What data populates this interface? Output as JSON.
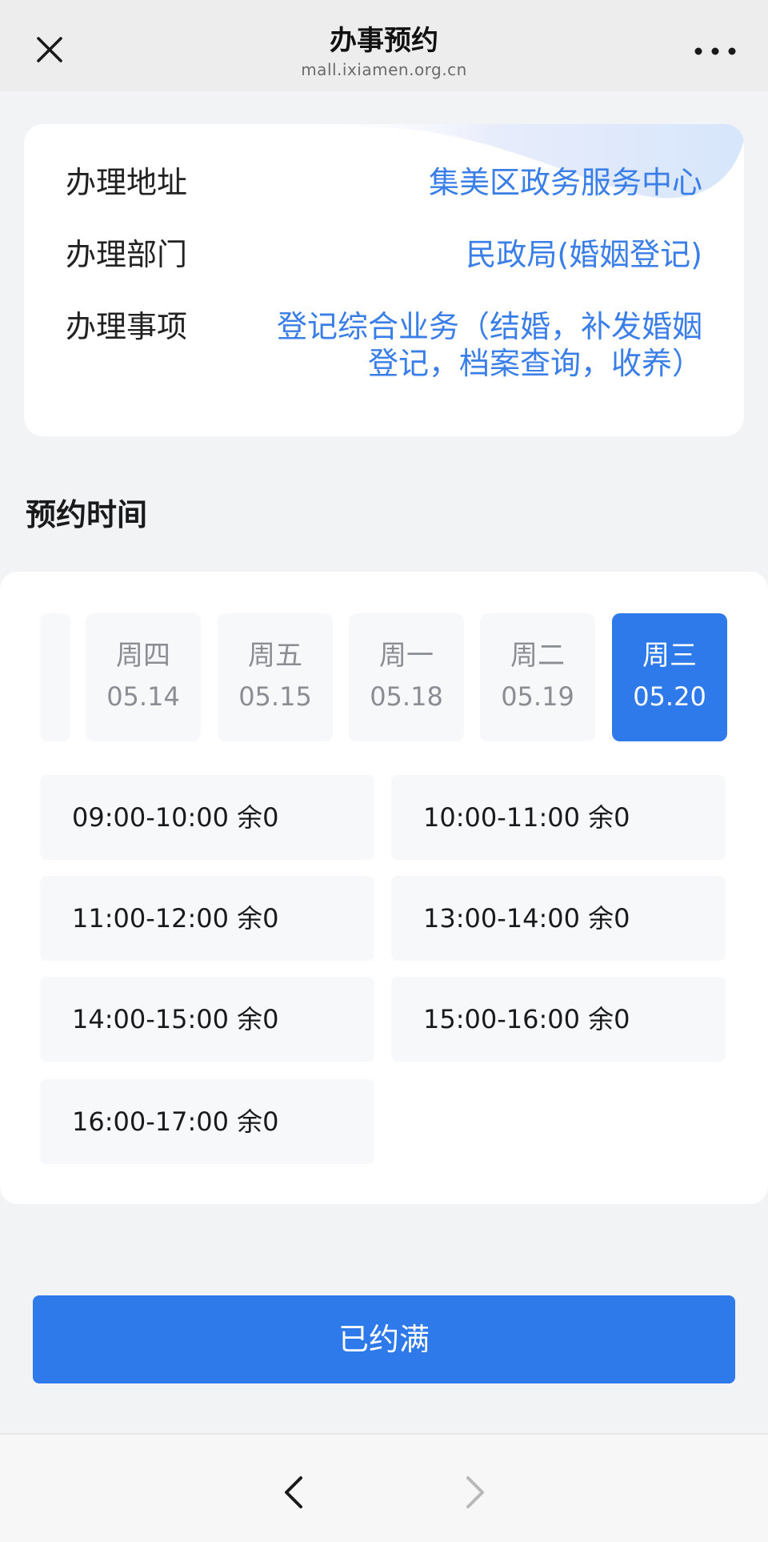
{
  "nav": {
    "title": "办事预约",
    "url": "mall.ixiamen.org.cn",
    "close_icon": "close-icon",
    "more_icon": "more-icon"
  },
  "info": {
    "address_label": "办理地址",
    "address_value": "集美区政务服务中心",
    "department_label": "办理部门",
    "department_value": "民政局(婚姻登记)",
    "matter_label": "办理事项",
    "matter_value_line1": "登记综合业务（结婚，补发婚姻",
    "matter_value_line2": "登记，档案查询，收养）"
  },
  "section_title": "预约时间",
  "dates": [
    {
      "weekday": "",
      "date": ""
    },
    {
      "weekday": "周四",
      "date": "05.14"
    },
    {
      "weekday": "周五",
      "date": "05.15"
    },
    {
      "weekday": "周一",
      "date": "05.18"
    },
    {
      "weekday": "周二",
      "date": "05.19"
    },
    {
      "weekday": "周三",
      "date": "05.20",
      "selected": true
    }
  ],
  "slots": [
    {
      "label": "09:00-10:00 余0"
    },
    {
      "label": "10:00-11:00 余0"
    },
    {
      "label": "11:00-12:00 余0"
    },
    {
      "label": "13:00-14:00 余0"
    },
    {
      "label": "14:00-15:00 余0"
    },
    {
      "label": "15:00-16:00 余0"
    },
    {
      "label": "16:00-17:00 余0"
    }
  ],
  "submit_label": "已约满",
  "colors": {
    "accent": "#2f7aea",
    "link": "#3a7ee8",
    "background": "#f2f3f5"
  }
}
